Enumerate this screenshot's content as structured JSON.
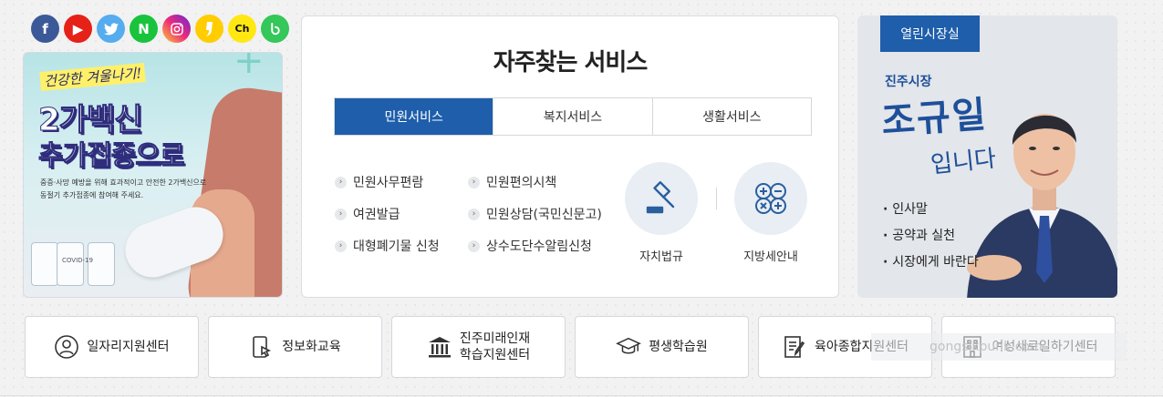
{
  "social": [
    {
      "name": "facebook",
      "glyph": "f"
    },
    {
      "name": "youtube",
      "glyph": "▶"
    },
    {
      "name": "twitter",
      "glyph": "🐦"
    },
    {
      "name": "naver",
      "glyph": "N"
    },
    {
      "name": "instagram",
      "glyph": "◎"
    },
    {
      "name": "kakaostory",
      "glyph": "❜"
    },
    {
      "name": "kakao-channel",
      "glyph": "Ch"
    },
    {
      "name": "band",
      "glyph": "b"
    }
  ],
  "banner": {
    "slogan": "건강한 겨울나기!",
    "line1": "2가백신",
    "line2": "추가접종으로",
    "small_text": "중증·사망 예방을 위해 효과적이고 안전한 2가백신으로 동절기 추가접종에 참여해 주세요.",
    "vial_label": "COVID-19"
  },
  "services": {
    "title": "자주찾는 서비스",
    "tabs": [
      "민원서비스",
      "복지서비스",
      "생활서비스"
    ],
    "active_tab": "민원서비스",
    "links": [
      "민원사무편람",
      "민원편의시책",
      "여권발급",
      "민원상담(국민신문고)",
      "대형폐기물 신청",
      "상수도단수알림신청"
    ],
    "quick": [
      {
        "label": "자치법규",
        "icon": "gavel-icon"
      },
      {
        "label": "지방세안내",
        "icon": "calculator-icon"
      }
    ]
  },
  "mayor": {
    "header": "열린시장실",
    "title": "진주시장",
    "name": "조규일",
    "greeting": "입니다",
    "menu": [
      "인사말",
      "공약과 실천",
      "시장에게 바란다"
    ]
  },
  "centers": [
    {
      "label": "일자리지원센터",
      "icon": "person-icon"
    },
    {
      "label": "정보화교육",
      "icon": "tablet-touch-icon"
    },
    {
      "label": "진주미래인재\n학습지원센터",
      "icon": "building-icon"
    },
    {
      "label": "평생학습원",
      "icon": "graduation-cap-icon"
    },
    {
      "label": "육아종합지원센터",
      "icon": "document-pen-icon"
    },
    {
      "label": "여성새로일하기센터",
      "icon": "office-building-icon"
    }
  ],
  "watermark": "gongsikpunk.com",
  "colors": {
    "primary": "#1e5eab",
    "background": "#f2f2f3"
  }
}
